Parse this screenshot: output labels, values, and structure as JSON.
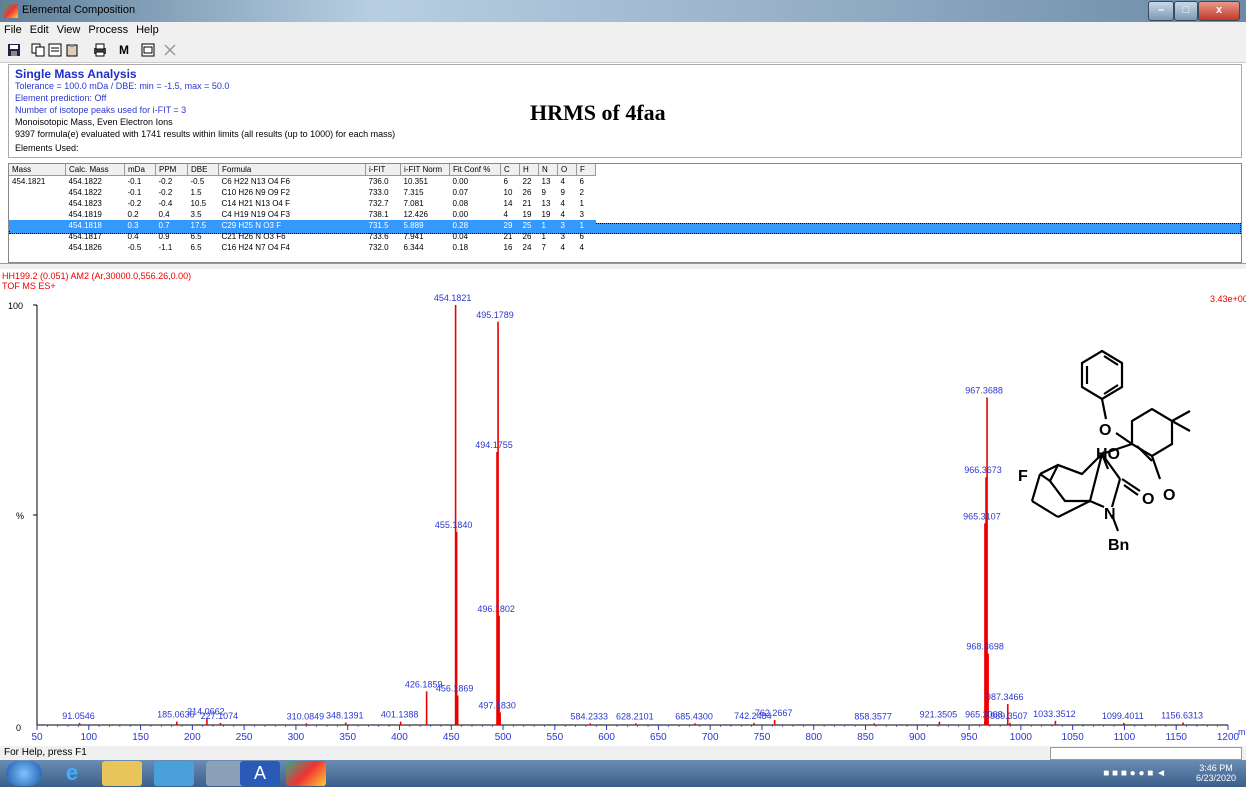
{
  "window": {
    "title": "Elemental Composition"
  },
  "menu": [
    "File",
    "Edit",
    "View",
    "Process",
    "Help"
  ],
  "toolbar_icons": [
    "save-icon",
    "copy-icon",
    "copy-all-icon",
    "paste-icon",
    "print-icon",
    "m-icon",
    "window-icon",
    "close-x-icon"
  ],
  "header": {
    "title": "Single Mass Analysis",
    "lines": [
      "Tolerance = 100.0 mDa   /   DBE: min = -1.5, max = 50.0",
      "Element prediction: Off",
      "Number of isotope peaks used for i-FIT = 3",
      "Monoisotopic Mass, Even Electron Ions",
      "9397 formula(e) evaluated with 1741 results within limits (all results (up to 1000) for each mass)",
      "Elements Used:"
    ],
    "annotation": "HRMS of 4faa"
  },
  "results_table": {
    "columns": [
      "Mass",
      "Calc. Mass",
      "mDa",
      "PPM",
      "DBE",
      "Formula",
      "i-FIT",
      "i-FIT Norm",
      "Fit Conf %",
      "C",
      "H",
      "N",
      "O",
      "F"
    ],
    "rows": [
      [
        "454.1821",
        "454.1822",
        "-0.1",
        "-0.2",
        "-0.5",
        "C6 H22 N13 O4 F6",
        "736.0",
        "10.351",
        "0.00",
        "6",
        "22",
        "13",
        "4",
        "6"
      ],
      [
        "",
        "454.1822",
        "-0.1",
        "-0.2",
        "1.5",
        "C10 H26 N9 O9 F2",
        "733.0",
        "7.315",
        "0.07",
        "10",
        "26",
        "9",
        "9",
        "2"
      ],
      [
        "",
        "454.1823",
        "-0.2",
        "-0.4",
        "10.5",
        "C14 H21 N13 O4 F",
        "732.7",
        "7.081",
        "0.08",
        "14",
        "21",
        "13",
        "4",
        "1"
      ],
      [
        "",
        "454.1819",
        "0.2",
        "0.4",
        "3.5",
        "C4 H19 N19 O4 F3",
        "738.1",
        "12.426",
        "0.00",
        "4",
        "19",
        "19",
        "4",
        "3"
      ],
      [
        "",
        "454.1818",
        "0.3",
        "0.7",
        "17.5",
        "C29 H25 N O3 F",
        "731.5",
        "5.889",
        "0.28",
        "29",
        "25",
        "1",
        "3",
        "1"
      ],
      [
        "",
        "454.1817",
        "0.4",
        "0.9",
        "6.5",
        "C21 H26 N O3 F6",
        "733.6",
        "7.941",
        "0.04",
        "21",
        "26",
        "1",
        "3",
        "6"
      ],
      [
        "",
        "454.1826",
        "-0.5",
        "-1.1",
        "6.5",
        "C16 H24 N7 O4 F4",
        "732.0",
        "6.344",
        "0.18",
        "16",
        "24",
        "7",
        "4",
        "4"
      ]
    ],
    "selected_row": 4
  },
  "spectrum_info": {
    "line1": "HH199.2 (0.051) AM2 (Ar,30000.0,556.26,0.00)",
    "line2": "TOF MS ES+",
    "intensity": "3.43e+00",
    "y_top_label": "100",
    "y_mid_label": "%",
    "y_zero_label": "0",
    "x_unit": "m"
  },
  "chart_data": {
    "type": "bar",
    "xlim": [
      50,
      1200
    ],
    "ylim": [
      0,
      100
    ],
    "xticks": [
      50,
      100,
      150,
      200,
      250,
      300,
      350,
      400,
      450,
      500,
      550,
      600,
      650,
      700,
      750,
      800,
      850,
      900,
      950,
      1000,
      1050,
      1100,
      1150,
      1200
    ],
    "peaks": [
      {
        "mz": 454.1821,
        "intensity": 100,
        "label": "454.1821"
      },
      {
        "mz": 495.1789,
        "intensity": 96,
        "label": "495.1789"
      },
      {
        "mz": 967.3688,
        "intensity": 78,
        "label": "967.3688"
      },
      {
        "mz": 966.3673,
        "intensity": 59,
        "label": "966.3673"
      },
      {
        "mz": 494.1755,
        "intensity": 65,
        "label": "494.1755"
      },
      {
        "mz": 965.3107,
        "intensity": 48,
        "label": "965.3107"
      },
      {
        "mz": 455.184,
        "intensity": 46,
        "label": "455.1840"
      },
      {
        "mz": 496.1802,
        "intensity": 26,
        "label": "496.1802"
      },
      {
        "mz": 968.3698,
        "intensity": 17,
        "label": "968.3698"
      },
      {
        "mz": 426.1859,
        "intensity": 8,
        "label": "426.1859"
      },
      {
        "mz": 456.1869,
        "intensity": 7,
        "label": "456.1869"
      },
      {
        "mz": 497.183,
        "intensity": 3,
        "label": "497.1830"
      },
      {
        "mz": 987.3466,
        "intensity": 5,
        "label": "987.3466"
      },
      {
        "mz": 91.0546,
        "intensity": 0.5,
        "label": "91.0546"
      },
      {
        "mz": 185.0636,
        "intensity": 0.8,
        "label": "185.0636"
      },
      {
        "mz": 214.0662,
        "intensity": 1.5,
        "label": "214.0662"
      },
      {
        "mz": 227.1074,
        "intensity": 0.5,
        "label": "227.1074"
      },
      {
        "mz": 310.0849,
        "intensity": 0.4,
        "label": "310.0849"
      },
      {
        "mz": 348.1391,
        "intensity": 0.6,
        "label": "348.1391"
      },
      {
        "mz": 401.1388,
        "intensity": 0.8,
        "label": "401.1388"
      },
      {
        "mz": 584.2333,
        "intensity": 0.4,
        "label": "584.2333"
      },
      {
        "mz": 628.2101,
        "intensity": 0.4,
        "label": "628.2101"
      },
      {
        "mz": 685.43,
        "intensity": 0.4,
        "label": "685.4300"
      },
      {
        "mz": 742.2484,
        "intensity": 0.5,
        "label": "742.2484"
      },
      {
        "mz": 762.2667,
        "intensity": 1.2,
        "label": "762.2667"
      },
      {
        "mz": 858.3577,
        "intensity": 0.4,
        "label": "858.3577"
      },
      {
        "mz": 921.3505,
        "intensity": 0.8,
        "label": "921.3505"
      },
      {
        "mz": 965.2068,
        "intensity": 0.8,
        "label": "965.2068"
      },
      {
        "mz": 989.3507,
        "intensity": 0.5,
        "label": "989.3507"
      },
      {
        "mz": 1033.3512,
        "intensity": 1.0,
        "label": "1033.3512"
      },
      {
        "mz": 1099.4011,
        "intensity": 0.5,
        "label": "1099.4011"
      },
      {
        "mz": 1156.6313,
        "intensity": 0.6,
        "label": "1156.6313"
      }
    ]
  },
  "structure_labels": {
    "O_ether": "O",
    "HO": "HO",
    "F": "F",
    "O_ketone": "O",
    "N": "N",
    "O_amide": "O",
    "Bn": "Bn"
  },
  "statusbar": {
    "text": "For Help, press F1"
  },
  "taskbar": {
    "time": "3:46 PM",
    "date": "6/23/2020"
  }
}
